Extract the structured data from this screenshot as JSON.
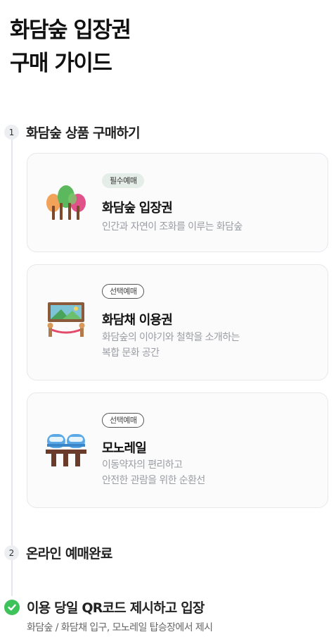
{
  "header": {
    "title_line1": "화담숲 입장권",
    "title_line2": "구매 가이드"
  },
  "steps": [
    {
      "number": "1",
      "label": "화담숲 상품 구매하기"
    },
    {
      "number": "2",
      "label": "온라인 예매완료"
    },
    {
      "icon": "check-circle-icon",
      "label": "이용 당일 QR코드 제시하고 입장",
      "sub": "화담숲 / 화담채 입구, 모노레일 탑승장에서 제시"
    }
  ],
  "cards": [
    {
      "icon": "trees-icon",
      "badge": "필수예매",
      "title": "화담숲 입장권",
      "desc_line1": "인간과 자연이 조화를 이루는 화담숲",
      "desc_line2": ""
    },
    {
      "icon": "gallery-painting-icon",
      "badge": "선택예매",
      "title": "화담채 이용권",
      "desc_line1": "화담숲의 이야기와 철학을 소개하는",
      "desc_line2": "복합 문화 공간"
    },
    {
      "icon": "monorail-icon",
      "badge": "선택예매",
      "title": "모노레일",
      "desc_line1": "이동약자의 편리하고",
      "desc_line2": "안전한 관람을 위한 순환선"
    }
  ],
  "colors": {
    "check_green": "#3ec25a",
    "required_badge_bg": "#e4ede8",
    "card_bg": "#fbfbfc",
    "description_gray": "#9a9da3"
  }
}
